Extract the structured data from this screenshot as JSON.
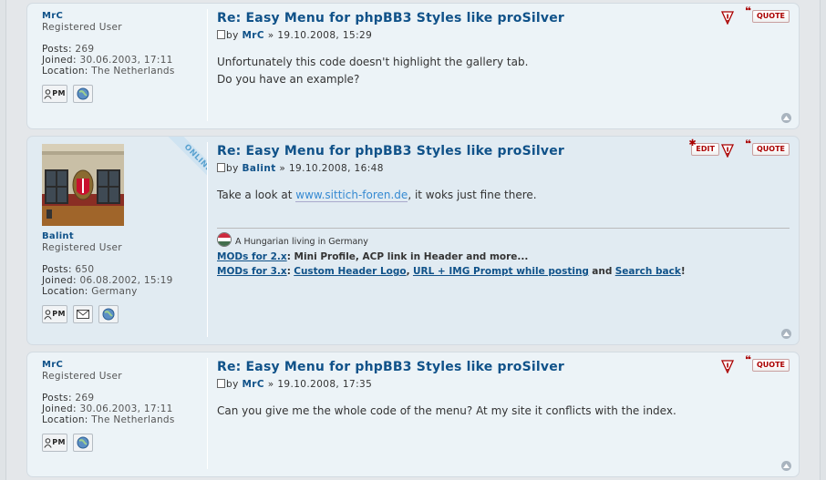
{
  "posts": [
    {
      "author": "MrC",
      "rank": "Registered User",
      "posts_label": "Posts:",
      "posts": "269",
      "joined_label": "Joined:",
      "joined": "30.06.2003, 17:11",
      "location_label": "Location:",
      "location": "The Netherlands",
      "title": "Re: Easy Menu for phpBB3 Styles like proSilver",
      "by": "by",
      "sep": "»",
      "date": "19.10.2008, 15:29",
      "line1": "Unfortunately this code doesn't highlight the gallery tab.",
      "line2": "Do you have an example?",
      "quote_label": "QUOTE",
      "pm_label": "PM"
    },
    {
      "author": "Balint",
      "rank": "Registered User",
      "online": "ONLINE",
      "posts_label": "Posts:",
      "posts": "650",
      "joined_label": "Joined:",
      "joined": "06.08.2002, 15:19",
      "location_label": "Location:",
      "location": "Germany",
      "title": "Re: Easy Menu for phpBB3 Styles like proSilver",
      "by": "by",
      "sep": "»",
      "date": "19.10.2008, 16:48",
      "text_before": "Take a look at ",
      "link": "www.sittich-foren.de",
      "text_after": ", it woks just fine there.",
      "edit_label": "EDIT",
      "quote_label": "QUOTE",
      "pm_label": "PM",
      "signature": {
        "line1": "A Hungarian living in Germany",
        "mods2_link": "MODs for 2.x",
        "mods2_text": ": Mini Profile, ACP link in Header and more...",
        "mods3_link": "MODs for 3.x",
        "colon": ":",
        "m1": "Custom Header Logo",
        "comma": ",",
        "m2": "URL + IMG Prompt while posting",
        "and": "and",
        "m3": "Search back",
        "excl": "!"
      }
    },
    {
      "author": "MrC",
      "rank": "Registered User",
      "posts_label": "Posts:",
      "posts": "269",
      "joined_label": "Joined:",
      "joined": "30.06.2003, 17:11",
      "location_label": "Location:",
      "location": "The Netherlands",
      "title": "Re: Easy Menu for phpBB3 Styles like proSilver",
      "by": "by",
      "sep": "»",
      "date": "19.10.2008, 17:35",
      "line1": "Can you give me the whole code of the menu? At my site it conflicts with the index.",
      "quote_label": "QUOTE",
      "pm_label": "PM"
    }
  ],
  "colors": {
    "link": "#105289",
    "button_text": "#aa0000",
    "bg1": "#e1ebf2",
    "bg2": "#ecf3f7"
  }
}
